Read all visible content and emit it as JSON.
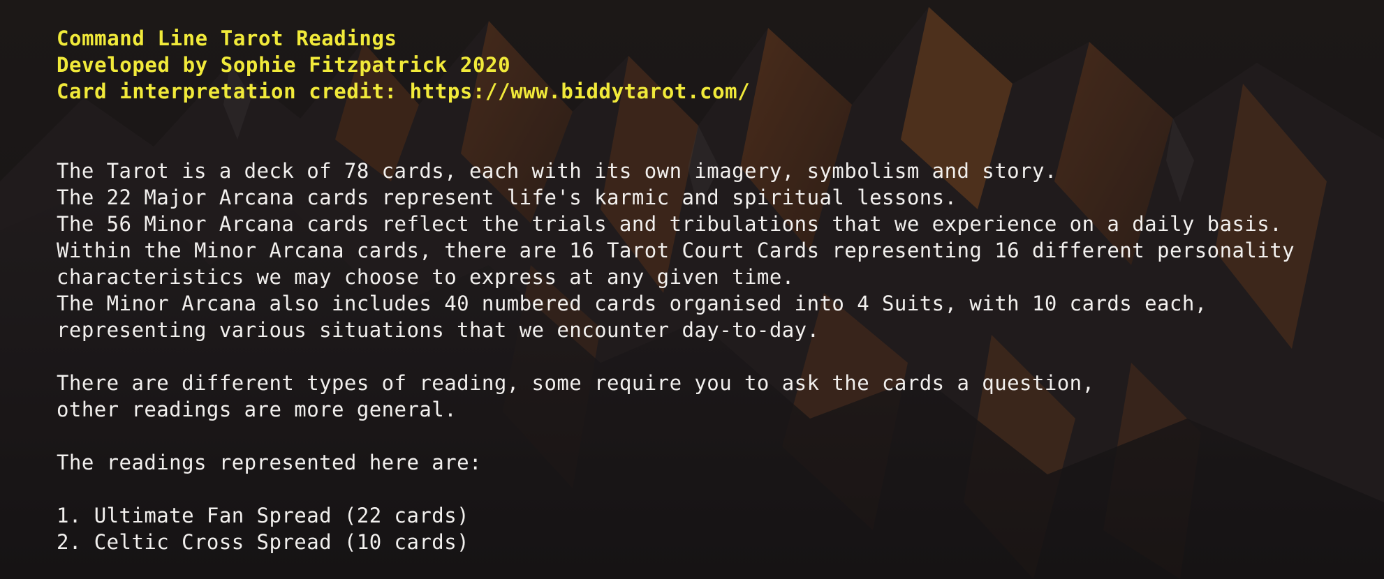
{
  "header": {
    "title": "Command Line Tarot Readings",
    "developer": "Developed by Sophie Fitzpatrick 2020",
    "credit": "Card interpretation credit: https://www.biddytarot.com/"
  },
  "intro": {
    "lines": [
      "The Tarot is a deck of 78 cards, each with its own imagery, symbolism and story.",
      "The 22 Major Arcana cards represent life's karmic and spiritual lessons.",
      "The 56 Minor Arcana cards reflect the trials and tribulations that we experience on a daily basis.",
      "Within the Minor Arcana cards, there are 16 Tarot Court Cards representing 16 different personality",
      "characteristics we may choose to express at any given time.",
      "The Minor Arcana also includes 40 numbered cards organised into 4 Suits, with 10 cards each,",
      "representing various situations that we encounter day-to-day."
    ]
  },
  "reading_types": {
    "lines": [
      "There are different types of reading, some require you to ask the cards a question,",
      "other readings are more general."
    ]
  },
  "readings": {
    "heading": "The readings represented here are:",
    "items": [
      "1. Ultimate Fan Spread (22 cards)",
      "2. Celtic Cross Spread (10 cards)"
    ]
  },
  "colors": {
    "background": "#1e1b1c",
    "header_text": "#f1ea3a",
    "body_text": "#f2f0ee",
    "rock_highlight": "#b4622a"
  }
}
